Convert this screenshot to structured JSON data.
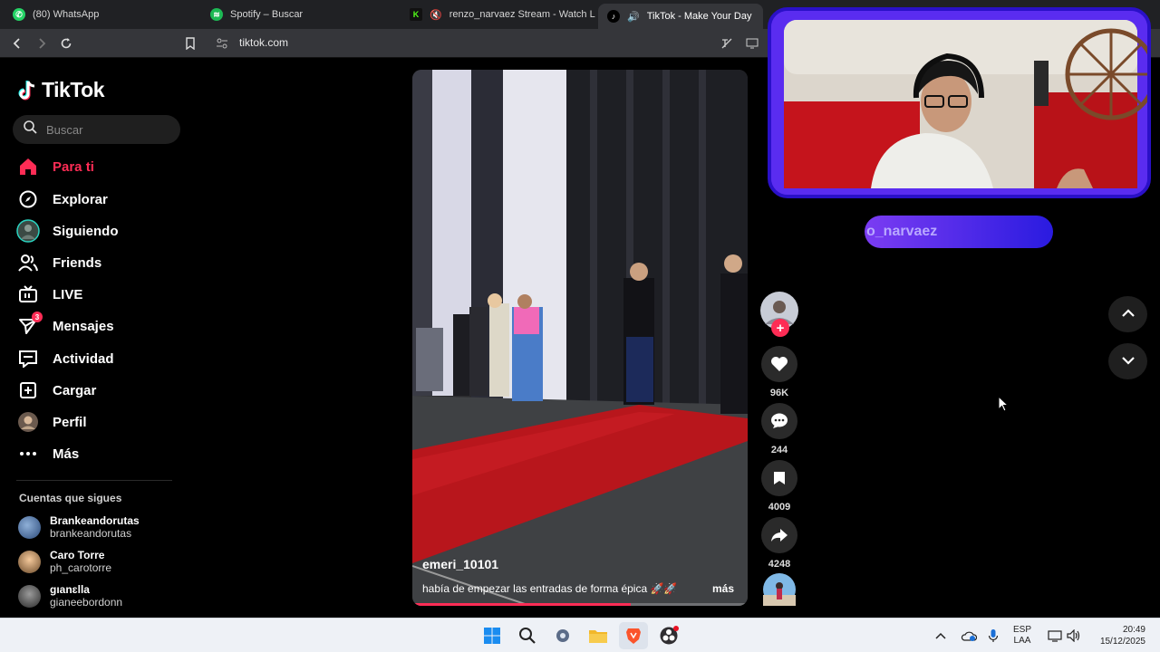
{
  "browser": {
    "tabs": [
      {
        "label": "(80) WhatsApp",
        "color": "#25d366"
      },
      {
        "label": "Spotify – Buscar",
        "color": "#1db954"
      },
      {
        "label": "renzo_narvaez Stream - Watch Li",
        "color": "#53fc18"
      },
      {
        "label": "TikTok - Make Your Day",
        "color": "#000000"
      }
    ],
    "url": "tiktok.com"
  },
  "sidebar": {
    "logo": "TikTok",
    "search_placeholder": "Buscar",
    "nav": [
      {
        "label": "Para ti",
        "icon": "home-icon",
        "active": true
      },
      {
        "label": "Explorar",
        "icon": "compass-icon"
      },
      {
        "label": "Siguiendo",
        "icon": "following-avatar-icon"
      },
      {
        "label": "Friends",
        "icon": "friends-icon"
      },
      {
        "label": "LIVE",
        "icon": "live-tv-icon"
      },
      {
        "label": "Mensajes",
        "icon": "send-icon",
        "badge": "3"
      },
      {
        "label": "Actividad",
        "icon": "activity-icon"
      },
      {
        "label": "Cargar",
        "icon": "upload-icon"
      },
      {
        "label": "Perfil",
        "icon": "profile-avatar-icon"
      },
      {
        "label": "Más",
        "icon": "more-dots-icon"
      }
    ],
    "following_title": "Cuentas que sigues",
    "following": [
      {
        "name": "Brankeandorutas",
        "handle": "brankeandorutas"
      },
      {
        "name": "Caro Torre",
        "handle": "ph_carotorre"
      },
      {
        "name": "gıanɛlla",
        "handle": "gianeebordonn"
      }
    ]
  },
  "video": {
    "username": "emeri_10101",
    "caption": "había de empezar las entradas de forma épica 🚀🚀",
    "more": "más",
    "progress": 0.65
  },
  "actions": {
    "likes": "96K",
    "comments": "244",
    "saves": "4009",
    "shares": "4248"
  },
  "overlay": {
    "name_badge": "o_narvaez"
  },
  "taskbar": {
    "language": "ESP",
    "layout": "LAA",
    "time": "20:49",
    "date": "15/12/2025"
  }
}
